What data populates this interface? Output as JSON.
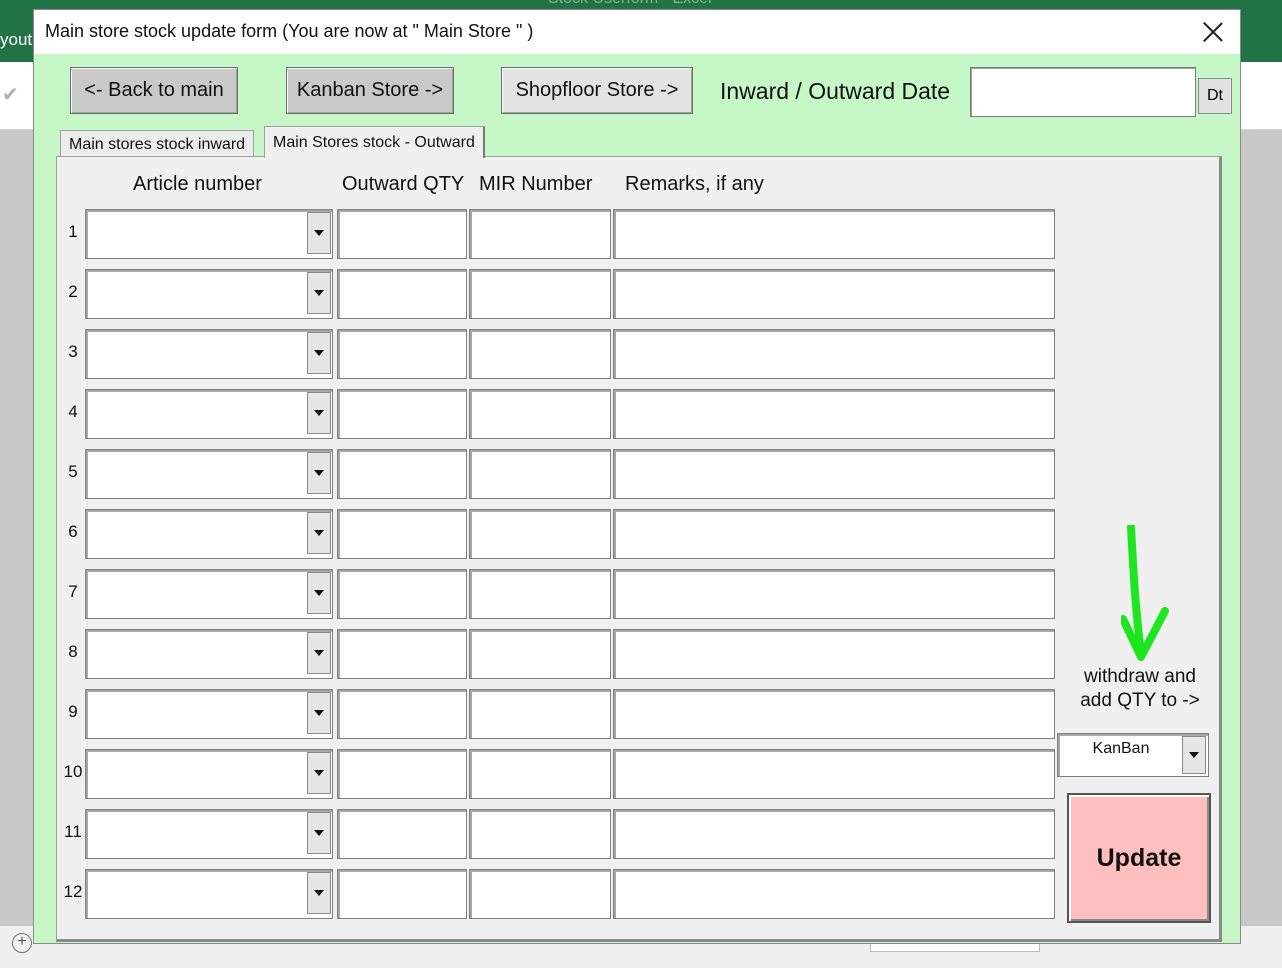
{
  "background": {
    "ribbon_fragment": "yout",
    "title_fragment": "Stock Userform - Excel"
  },
  "dialog": {
    "title": "Main store stock update form  (You are now at \" Main Store \" )"
  },
  "toolbar": {
    "back_label": "<- Back to main",
    "kanban_label": "Kanban Store ->",
    "shopfloor_label": "Shopfloor Store ->",
    "date_label": "Inward / Outward Date",
    "date_value": "",
    "dt_label": "Dt"
  },
  "tabs": [
    {
      "label": "Main stores stock inward",
      "active": false
    },
    {
      "label": "Main Stores stock - Outward",
      "active": true
    }
  ],
  "table": {
    "headers": {
      "article": "Article number",
      "qty": "Outward QTY",
      "mir": "MIR Number",
      "remarks": "Remarks, if any"
    },
    "rows": [
      {
        "num": "1",
        "article": "",
        "qty": "",
        "mir": "",
        "remarks": ""
      },
      {
        "num": "2",
        "article": "",
        "qty": "",
        "mir": "",
        "remarks": ""
      },
      {
        "num": "3",
        "article": "",
        "qty": "",
        "mir": "",
        "remarks": ""
      },
      {
        "num": "4",
        "article": "",
        "qty": "",
        "mir": "",
        "remarks": ""
      },
      {
        "num": "5",
        "article": "",
        "qty": "",
        "mir": "",
        "remarks": ""
      },
      {
        "num": "6",
        "article": "",
        "qty": "",
        "mir": "",
        "remarks": ""
      },
      {
        "num": "7",
        "article": "",
        "qty": "",
        "mir": "",
        "remarks": ""
      },
      {
        "num": "8",
        "article": "",
        "qty": "",
        "mir": "",
        "remarks": ""
      },
      {
        "num": "9",
        "article": "",
        "qty": "",
        "mir": "",
        "remarks": ""
      },
      {
        "num": "10",
        "article": "",
        "qty": "",
        "mir": "",
        "remarks": ""
      },
      {
        "num": "11",
        "article": "",
        "qty": "",
        "mir": "",
        "remarks": ""
      },
      {
        "num": "12",
        "article": "",
        "qty": "",
        "mir": "",
        "remarks": ""
      }
    ]
  },
  "side": {
    "withdraw_line1": "withdraw and",
    "withdraw_line2": "add QTY to ->",
    "destination_value": "KanBan",
    "update_label": "Update"
  },
  "colors": {
    "dialog_bg": "#c6f7c6",
    "update_bg": "#ffbfbf",
    "annotation_arrow": "#1ee61e",
    "excel_green": "#217346"
  },
  "icons": {
    "close": "close-icon",
    "dropdown": "chevron-down-icon",
    "annotation": "arrow-down-annotation"
  }
}
